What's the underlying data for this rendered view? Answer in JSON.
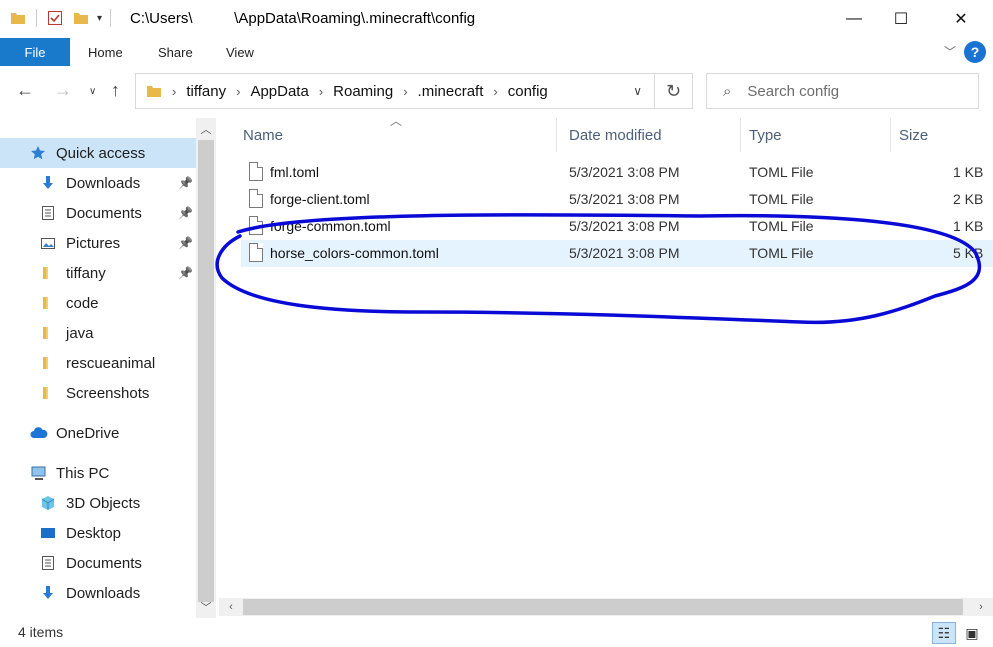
{
  "window": {
    "title": "C:\\Users\\          \\AppData\\Roaming\\.minecraft\\config",
    "controls": {
      "minimize": "—",
      "maximize": "☐",
      "close": "✕"
    }
  },
  "ribbon": {
    "tabs": [
      "File",
      "Home",
      "Share",
      "View"
    ],
    "help": "?"
  },
  "address": {
    "breadcrumbs": [
      "tiffany",
      "AppData",
      "Roaming",
      ".minecraft",
      "config"
    ],
    "search_placeholder": "Search config"
  },
  "nav": {
    "items": [
      {
        "label": "Quick access",
        "icon": "star-icon",
        "selected": true,
        "pinned": false
      },
      {
        "label": "Downloads",
        "icon": "download-icon",
        "pinned": true
      },
      {
        "label": "Documents",
        "icon": "document-icon",
        "pinned": true
      },
      {
        "label": "Pictures",
        "icon": "pictures-icon",
        "pinned": true
      },
      {
        "label": "tiffany",
        "icon": "folder-icon",
        "pinned": true
      },
      {
        "label": "code",
        "icon": "folder-icon",
        "pinned": false
      },
      {
        "label": "java",
        "icon": "folder-icon",
        "pinned": false
      },
      {
        "label": "rescueanimal",
        "icon": "folder-icon",
        "pinned": false
      },
      {
        "label": "Screenshots",
        "icon": "folder-icon",
        "pinned": false
      },
      {
        "label": "OneDrive",
        "icon": "cloud-icon",
        "pinned": false
      },
      {
        "label": "This PC",
        "icon": "pc-icon",
        "pinned": false
      },
      {
        "label": "3D Objects",
        "icon": "cube-icon",
        "pinned": false
      },
      {
        "label": "Desktop",
        "icon": "desktop-icon",
        "pinned": false
      },
      {
        "label": "Documents",
        "icon": "document-icon",
        "pinned": false
      },
      {
        "label": "Downloads",
        "icon": "download-icon",
        "pinned": false
      }
    ]
  },
  "files": {
    "columns": [
      "Name",
      "Date modified",
      "Type",
      "Size"
    ],
    "rows": [
      {
        "name": "fml.toml",
        "date": "5/3/2021 3:08 PM",
        "type": "TOML File",
        "size": "1 KB"
      },
      {
        "name": "forge-client.toml",
        "date": "5/3/2021 3:08 PM",
        "type": "TOML File",
        "size": "2 KB"
      },
      {
        "name": "forge-common.toml",
        "date": "5/3/2021 3:08 PM",
        "type": "TOML File",
        "size": "1 KB"
      },
      {
        "name": "horse_colors-common.toml",
        "date": "5/3/2021 3:08 PM",
        "type": "TOML File",
        "size": "5 KB"
      }
    ]
  },
  "status": {
    "item_count": "4 items"
  },
  "colors": {
    "accent": "#1979ca",
    "selection": "#cce4f7",
    "annotation": "#0a0ad6"
  }
}
